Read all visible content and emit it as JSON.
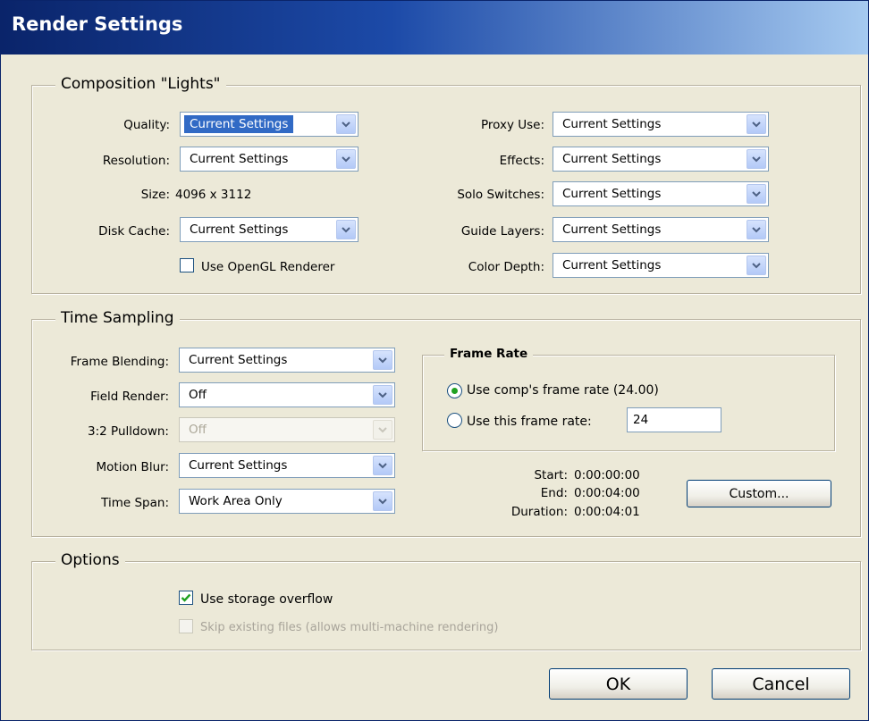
{
  "window": {
    "title": "Render Settings"
  },
  "composition": {
    "legend": "Composition \"Lights\"",
    "quality": {
      "label": "Quality:",
      "value": "Current Settings"
    },
    "resolution": {
      "label": "Resolution:",
      "value": "Current Settings"
    },
    "size": {
      "label": "Size:",
      "value": "4096 x 3112"
    },
    "disk_cache": {
      "label": "Disk Cache:",
      "value": "Current Settings"
    },
    "opengl": {
      "label": "Use OpenGL Renderer",
      "checked": false
    },
    "proxy_use": {
      "label": "Proxy Use:",
      "value": "Current Settings"
    },
    "effects": {
      "label": "Effects:",
      "value": "Current Settings"
    },
    "solo_switches": {
      "label": "Solo Switches:",
      "value": "Current Settings"
    },
    "guide_layers": {
      "label": "Guide Layers:",
      "value": "Current Settings"
    },
    "color_depth": {
      "label": "Color Depth:",
      "value": "Current Settings"
    }
  },
  "time_sampling": {
    "legend": "Time Sampling",
    "frame_blending": {
      "label": "Frame Blending:",
      "value": "Current Settings"
    },
    "field_render": {
      "label": "Field Render:",
      "value": "Off"
    },
    "pulldown": {
      "label": "3:2 Pulldown:",
      "value": "Off",
      "disabled": true
    },
    "motion_blur": {
      "label": "Motion Blur:",
      "value": "Current Settings"
    },
    "time_span": {
      "label": "Time Span:",
      "value": "Work Area Only"
    },
    "frame_rate": {
      "legend": "Frame Rate",
      "use_comp": {
        "label": "Use comp's frame rate (24.00)",
        "selected": true
      },
      "use_this": {
        "label": "Use this frame rate:",
        "selected": false
      },
      "value": "24"
    },
    "start": {
      "label": "Start:",
      "value": "0:00:00:00"
    },
    "end": {
      "label": "End:",
      "value": "0:00:04:00"
    },
    "duration": {
      "label": "Duration:",
      "value": "0:00:04:01"
    },
    "custom_button": "Custom..."
  },
  "options": {
    "legend": "Options",
    "storage_overflow": {
      "label": "Use storage overflow",
      "checked": true
    },
    "skip_existing": {
      "label": "Skip existing files (allows multi-machine rendering)",
      "checked": false,
      "disabled": true
    }
  },
  "buttons": {
    "ok": "OK",
    "cancel": "Cancel"
  },
  "colors": {
    "title_bar": "#0a246a",
    "dialog_bg": "#ece9d8",
    "selection": "#316ac5",
    "check_green": "#21a121"
  }
}
